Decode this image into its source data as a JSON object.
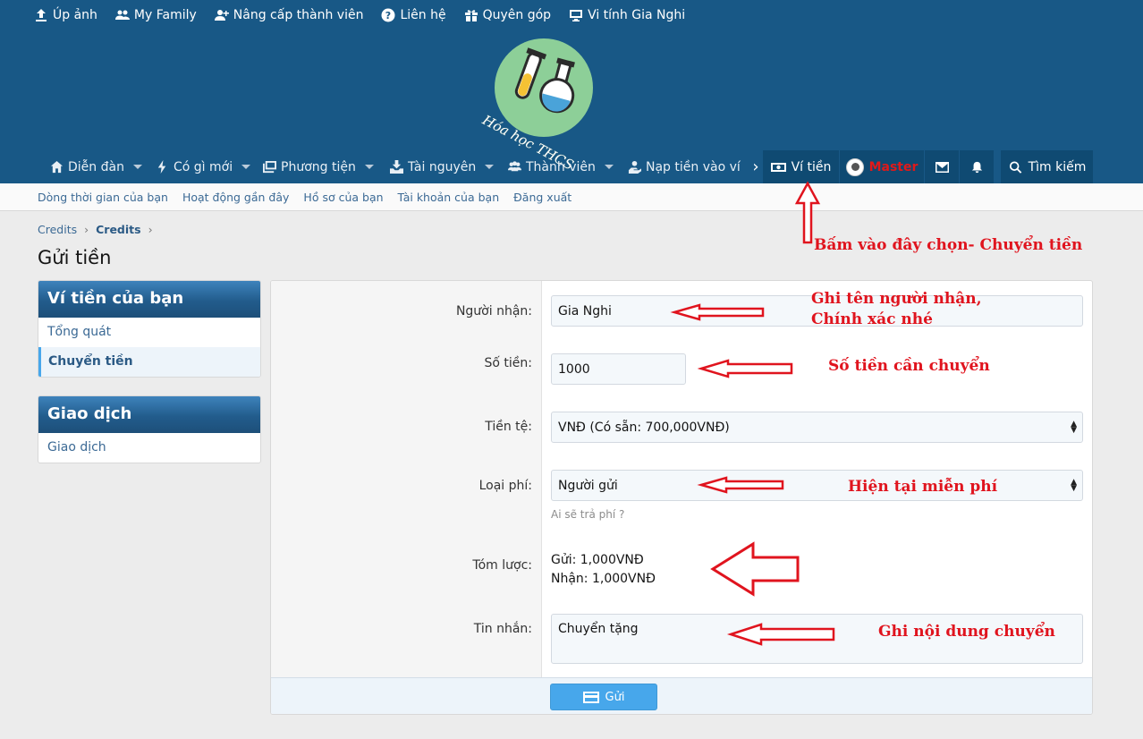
{
  "topnav": [
    {
      "label": "Úp ảnh",
      "icon": "upload-icon"
    },
    {
      "label": "My Family",
      "icon": "users-icon"
    },
    {
      "label": "Nâng cấp thành viên",
      "icon": "user-plus-icon"
    },
    {
      "label": "Liên hệ",
      "icon": "question-circle-icon"
    },
    {
      "label": "Quyên góp",
      "icon": "gift-icon"
    },
    {
      "label": "Vi tính Gia Nghi",
      "icon": "desktop-icon"
    }
  ],
  "logo": {
    "text": "Hóa học THCS"
  },
  "mainnav": {
    "tabs": [
      {
        "label": "Diễn đàn"
      },
      {
        "label": "Có gì mới"
      },
      {
        "label": "Phương tiện"
      },
      {
        "label": "Tài nguyên"
      },
      {
        "label": "Thành viên"
      },
      {
        "label": "Nạp tiền vào ví"
      }
    ],
    "next": "›",
    "wallet": "Ví tiền",
    "user": "Master",
    "search": "Tìm kiếm"
  },
  "subnav": [
    "Dòng thời gian của bạn",
    "Hoạt động gần đây",
    "Hồ sơ của bạn",
    "Tài khoản của bạn",
    "Đăng xuất"
  ],
  "breadcrumb": [
    "Credits",
    "Credits"
  ],
  "page_title": "Gửi tiền",
  "sidebar": {
    "wallet_block": {
      "title": "Ví tiền của bạn",
      "items": [
        "Tổng quát",
        "Chuyển tiền"
      ]
    },
    "transactions_block": {
      "title": "Giao dịch",
      "items": [
        "Giao dịch"
      ]
    }
  },
  "form": {
    "recipient": {
      "label": "Người nhận:",
      "value": "Gia Nghi"
    },
    "amount": {
      "label": "Số tiền:",
      "value": "1000"
    },
    "currency": {
      "label": "Tiền tệ:",
      "value": "VNĐ (Có sẵn: 700,000VNĐ)"
    },
    "fee": {
      "label": "Loại phí:",
      "value": "Người gửi",
      "hint": "Ai sẽ trả phí ?"
    },
    "summary": {
      "label": "Tóm lược:",
      "send": "Gửi: 1,000VNĐ",
      "receive": "Nhận: 1,000VNĐ"
    },
    "message": {
      "label": "Tin nhắn:",
      "value": "Chuyển tặng"
    },
    "submit": "Gửi"
  },
  "annotations": {
    "click_here": "Bấm vào đây chọn- Chuyển tiền",
    "recipient_line1": "Ghi tên người nhận,",
    "recipient_line2": "Chính xác nhé",
    "amount": "Số tiền cần chuyển",
    "fee": "Hiện tại miễn phí",
    "message": "Ghi nội dung chuyển"
  },
  "colors": {
    "header": "#185886",
    "accent": "#47a7eb",
    "annotation": "#e0141e",
    "user": "#e11919"
  }
}
